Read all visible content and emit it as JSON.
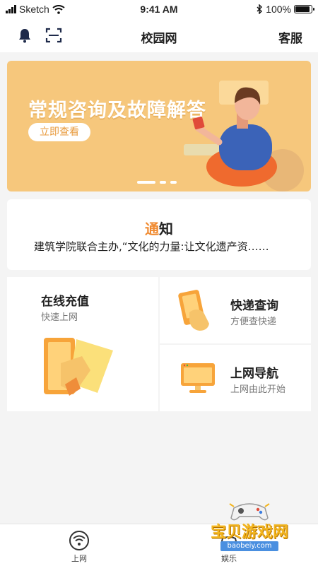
{
  "status_bar": {
    "carrier": "Sketch",
    "time": "9:41 AM",
    "battery": "100%",
    "battery_level": 1.0
  },
  "nav": {
    "title": "校园网",
    "service_label": "客服",
    "icons": [
      "bell-icon",
      "scan-icon"
    ]
  },
  "banner": {
    "heading": "常规咨询及故障解答",
    "cta_label": "立即查看",
    "page_count": 3,
    "active_page": 1
  },
  "notice": {
    "title_accent": "通",
    "title_rest": "知",
    "text": "建筑学院联合主办,“文化的力量:让文化遗产资……"
  },
  "services": [
    {
      "title": "在线充值",
      "subtitle": "快速上网",
      "icon": "recharge-card-icon"
    },
    {
      "title": "快递查询",
      "subtitle": "方便查快递",
      "icon": "phone-hand-icon"
    },
    {
      "title": "上网导航",
      "subtitle": "上网由此开始",
      "icon": "monitor-icon"
    }
  ],
  "tabs": [
    {
      "label": "上网",
      "icon": "wifi-icon",
      "active": true
    },
    {
      "label": "娱乐",
      "icon": "game-icon",
      "active": false
    }
  ],
  "watermark": {
    "text": "宝贝游戏网",
    "url": "baobeiy.com"
  },
  "colors": {
    "accent": "#f08a30",
    "banner_bg": "#f6c77c",
    "watermark": "#f3b51e"
  }
}
